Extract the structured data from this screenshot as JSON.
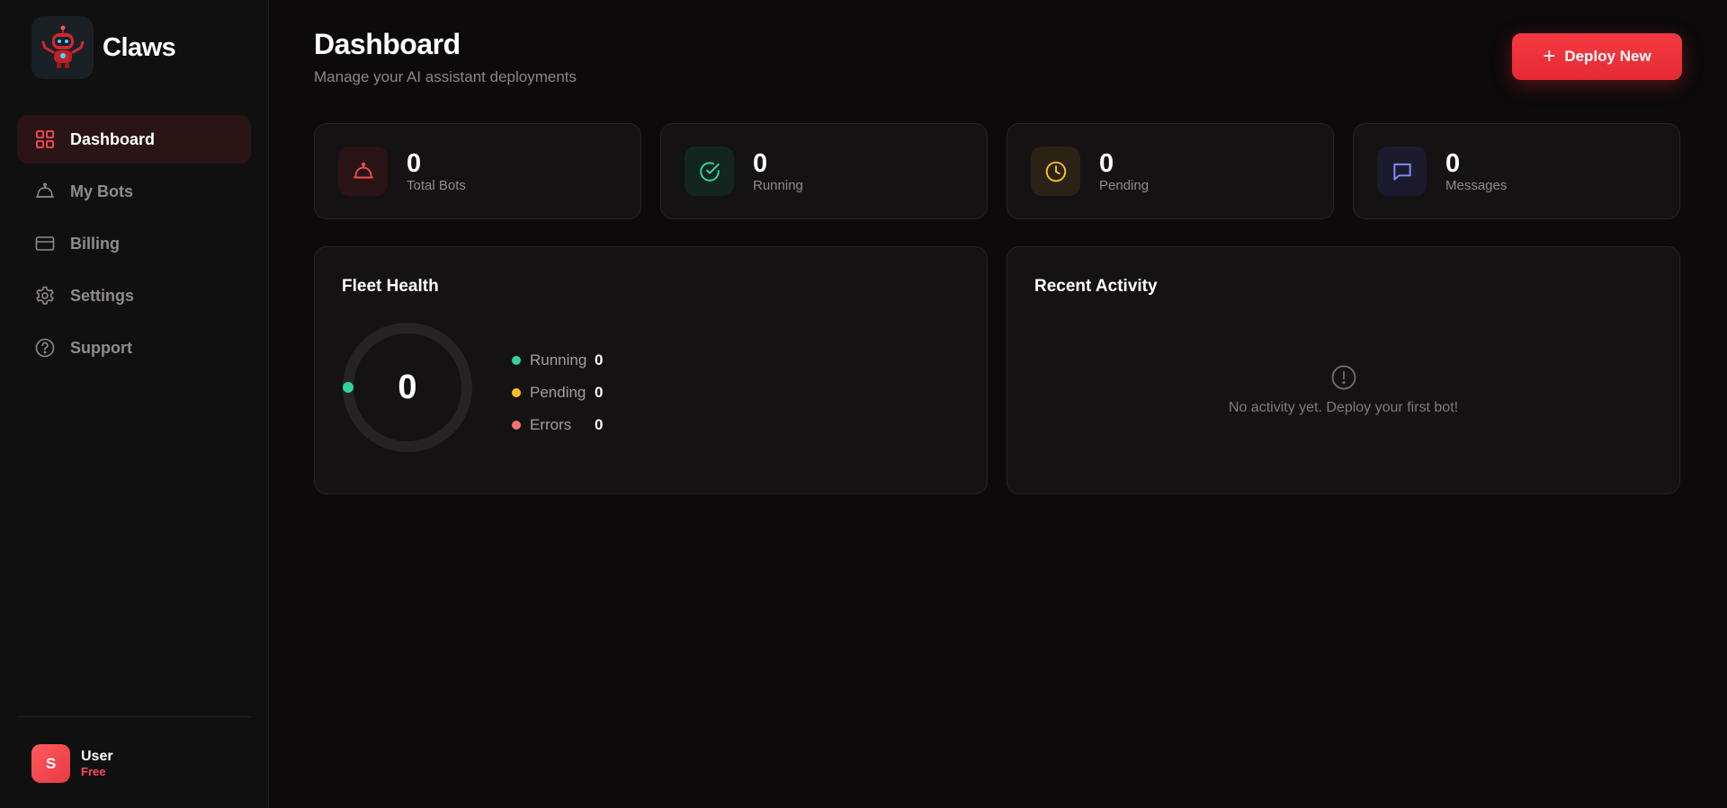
{
  "brand": {
    "name": "Claws",
    "logo_icon": "robot-icon"
  },
  "sidebar": {
    "items": [
      {
        "label": "Dashboard",
        "icon": "grid-icon",
        "active": true
      },
      {
        "label": "My Bots",
        "icon": "bot-icon",
        "active": false
      },
      {
        "label": "Billing",
        "icon": "credit-card-icon",
        "active": false
      },
      {
        "label": "Settings",
        "icon": "gear-icon",
        "active": false
      },
      {
        "label": "Support",
        "icon": "help-circle-icon",
        "active": false
      }
    ]
  },
  "user": {
    "initial": "S",
    "name": "User",
    "plan": "Free"
  },
  "header": {
    "title": "Dashboard",
    "subtitle": "Manage your AI assistant deployments",
    "deploy_label": "Deploy New"
  },
  "stats": [
    {
      "value": "0",
      "label": "Total Bots",
      "icon": "bot-icon",
      "color": "#ff4d55"
    },
    {
      "value": "0",
      "label": "Running",
      "icon": "check-circle-icon",
      "color": "#34d399"
    },
    {
      "value": "0",
      "label": "Pending",
      "icon": "clock-icon",
      "color": "#fbbf24"
    },
    {
      "value": "0",
      "label": "Messages",
      "icon": "message-square-icon",
      "color": "#818cf8"
    }
  ],
  "fleet_health": {
    "title": "Fleet Health",
    "total": "0",
    "legend": [
      {
        "label": "Running",
        "value": "0",
        "color": "#34d399"
      },
      {
        "label": "Pending",
        "value": "0",
        "color": "#fbbf24"
      },
      {
        "label": "Errors",
        "value": "0",
        "color": "#f87171"
      }
    ]
  },
  "recent_activity": {
    "title": "Recent Activity",
    "empty_text": "No activity yet. Deploy your first bot!",
    "empty_icon": "alert-circle-icon"
  },
  "colors": {
    "accent": "#f53a42",
    "background": "#0c0a0b",
    "card": "#141213"
  }
}
